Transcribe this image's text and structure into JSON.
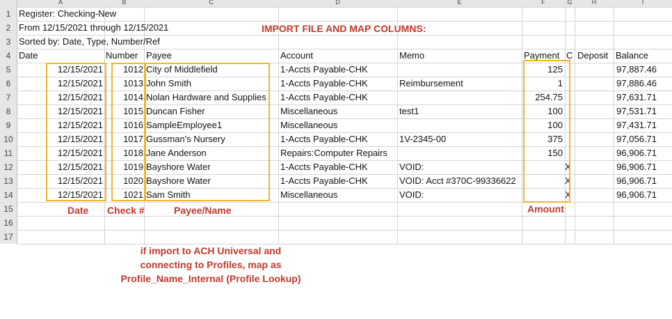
{
  "columns": [
    "A",
    "B",
    "C",
    "D",
    "E",
    "F",
    "G",
    "H",
    "I"
  ],
  "row_numbers": [
    "1",
    "2",
    "3",
    "4",
    "5",
    "6",
    "7",
    "8",
    "9",
    "10",
    "11",
    "12",
    "13",
    "14",
    "15",
    "16",
    "17"
  ],
  "header_text": {
    "register": "Register: Checking-New",
    "range": "From 12/15/2021 through 12/15/2021",
    "sorted": "Sorted by: Date, Type, Number/Ref"
  },
  "table_headers": {
    "date": "Date",
    "number": "Number",
    "payee": "Payee",
    "account": "Account",
    "memo": "Memo",
    "payment": "Payment",
    "c": "C",
    "deposit": "Deposit",
    "balance": "Balance"
  },
  "rows": [
    {
      "date": "12/15/2021",
      "number": "1012",
      "payee": "City of Middlefield",
      "account": "1-Accts Payable-CHK",
      "memo": "",
      "payment": "125",
      "c": "",
      "balance": "97,887.46"
    },
    {
      "date": "12/15/2021",
      "number": "1013",
      "payee": "John Smith",
      "account": "1-Accts Payable-CHK",
      "memo": "Reimbursement",
      "payment": "1",
      "c": "",
      "balance": "97,886.46"
    },
    {
      "date": "12/15/2021",
      "number": "1014",
      "payee": "Nolan Hardware and Supplies",
      "account": "1-Accts Payable-CHK",
      "memo": "",
      "payment": "254.75",
      "c": "",
      "balance": "97,631.71"
    },
    {
      "date": "12/15/2021",
      "number": "1015",
      "payee": "Duncan Fisher",
      "account": "Miscellaneous",
      "memo": "test1",
      "payment": "100",
      "c": "",
      "balance": "97,531.71"
    },
    {
      "date": "12/15/2021",
      "number": "1016",
      "payee": "SampleEmployee1",
      "account": "Miscellaneous",
      "memo": "",
      "payment": "100",
      "c": "",
      "balance": "97,431.71"
    },
    {
      "date": "12/15/2021",
      "number": "1017",
      "payee": "Gussman's Nursery",
      "account": "1-Accts Payable-CHK",
      "memo": "1V-2345-00",
      "payment": "375",
      "c": "",
      "balance": "97,056.71"
    },
    {
      "date": "12/15/2021",
      "number": "1018",
      "payee": "Jane Anderson",
      "account": "Repairs:Computer Repairs",
      "memo": "",
      "payment": "150",
      "c": "",
      "balance": "96,906.71"
    },
    {
      "date": "12/15/2021",
      "number": "1019",
      "payee": "Bayshore Water",
      "account": "1-Accts Payable-CHK",
      "memo": "VOID:",
      "payment": "",
      "c": "X",
      "balance": "96,906.71"
    },
    {
      "date": "12/15/2021",
      "number": "1020",
      "payee": "Bayshore Water",
      "account": "1-Accts Payable-CHK",
      "memo": "VOID:  Acct #370C-99336622",
      "payment": "",
      "c": "X",
      "balance": "96,906.71"
    },
    {
      "date": "12/15/2021",
      "number": "1021",
      "payee": "Sam Smith",
      "account": "Miscellaneous",
      "memo": "VOID:",
      "payment": "",
      "c": "X",
      "balance": "96,906.71"
    }
  ],
  "annotations": {
    "title": "IMPORT FILE AND MAP COLUMNS:",
    "date_label": "Date",
    "check_label": "Check #",
    "payee_label": "Payee/Name",
    "amount_label": "Amount",
    "note_line1": "if import to ACH Universal and",
    "note_line2": "connecting to Profiles, map as",
    "note_line3": "Profile_Name_Internal (Profile Lookup)"
  }
}
